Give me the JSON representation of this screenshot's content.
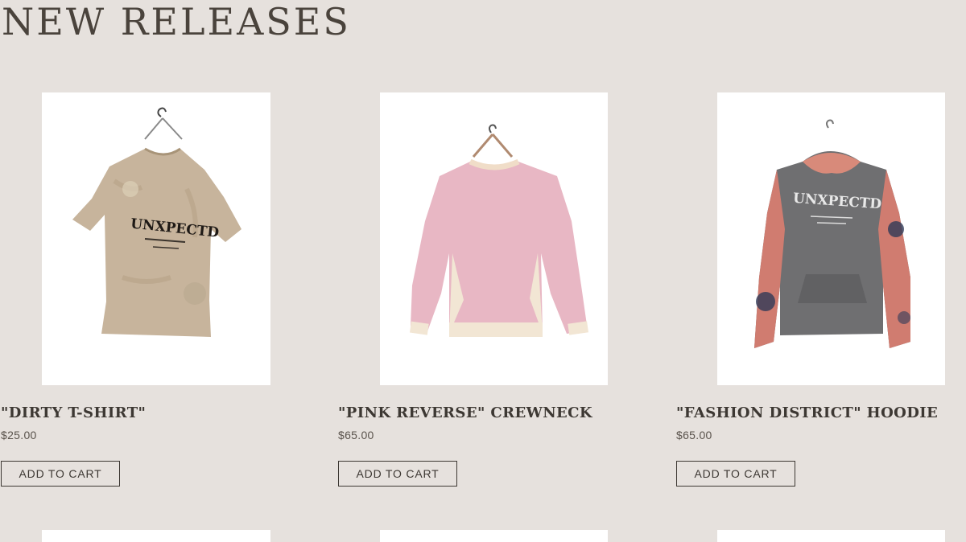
{
  "section": {
    "title": "NEW RELEASES"
  },
  "products": [
    {
      "name": "\"DIRTY T-SHIRT\"",
      "price": "$25.00",
      "button": "ADD TO CART",
      "print": "UNXPECTD"
    },
    {
      "name": "\"PINK REVERSE\" CREWNECK",
      "price": "$65.00",
      "button": "ADD TO CART"
    },
    {
      "name": "\"FASHION DISTRICT\" HOODIE",
      "price": "$65.00",
      "button": "ADD TO CART",
      "print": "UNXPECTD"
    }
  ]
}
